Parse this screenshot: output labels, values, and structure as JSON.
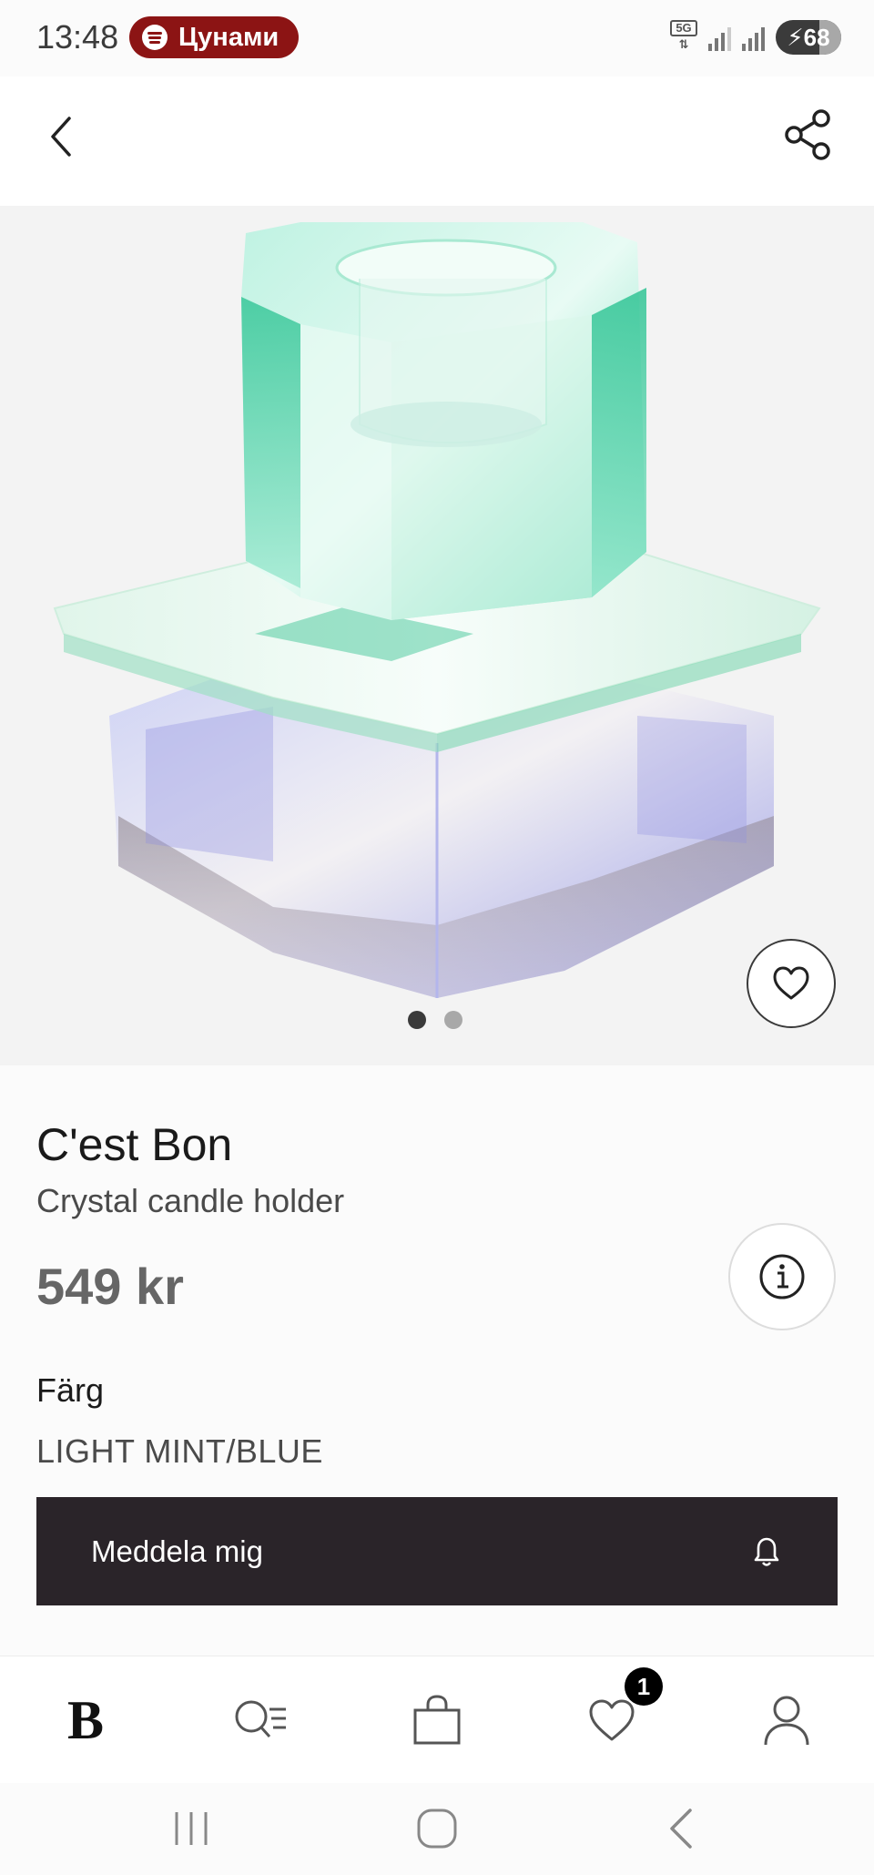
{
  "status_bar": {
    "time": "13:48",
    "media_pill": "Цунами",
    "network": "5G",
    "battery": "68",
    "colors": {
      "pill": "#8c1414"
    }
  },
  "top_nav": {
    "back_icon": "chevron-left-icon",
    "share_icon": "share-icon"
  },
  "gallery": {
    "slide_count": 2,
    "active_index": 0
  },
  "product": {
    "brand": "C'est Bon",
    "name": "Crystal candle holder",
    "price": "549 kr",
    "color_label": "Färg",
    "color_value": "LIGHT MINT/BLUE"
  },
  "actions": {
    "notify_label": "Meddela mig",
    "notify_color": "#2a2429"
  },
  "bottom_nav": {
    "logo": "B",
    "wishlist_count": "1",
    "items": [
      "home-logo",
      "search-icon",
      "bag-icon",
      "heart-icon",
      "profile-icon"
    ]
  }
}
